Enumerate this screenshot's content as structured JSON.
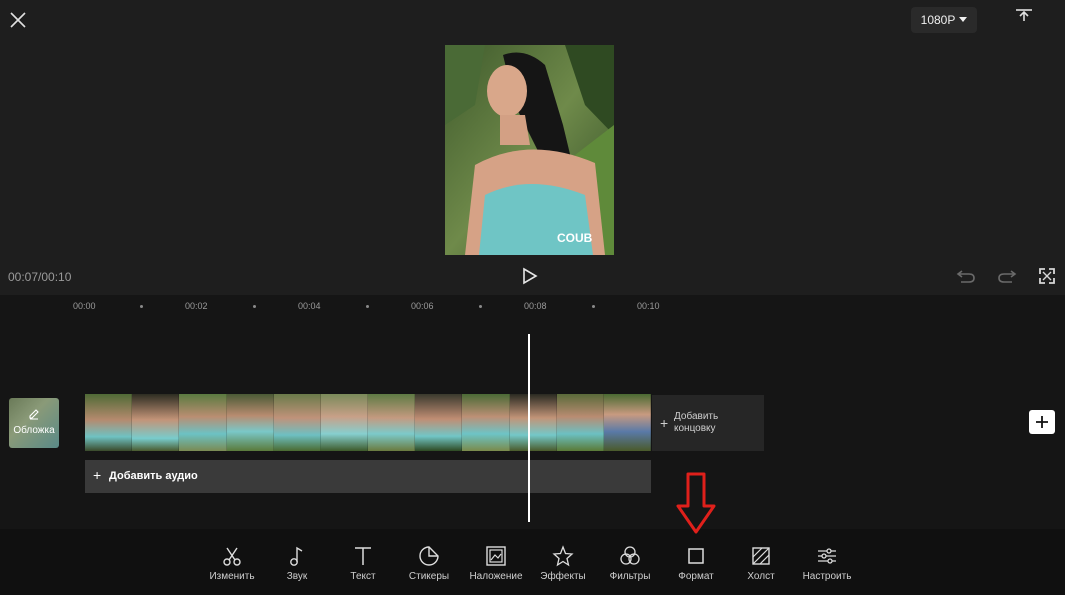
{
  "header": {
    "resolution": "1080P"
  },
  "preview": {
    "watermark": "COUB"
  },
  "playback": {
    "time": "00:07/00:10"
  },
  "ruler": {
    "ticks": [
      "00:00",
      "00:02",
      "00:04",
      "00:06",
      "00:08",
      "00:10"
    ]
  },
  "tracks": {
    "cover_label": "Обложка",
    "add_ending_line1": "Добавить",
    "add_ending_line2": "концовку",
    "add_audio": "Добавить аудио"
  },
  "toolbar": {
    "items": [
      {
        "label": "Изменить",
        "icon": "scissors-icon"
      },
      {
        "label": "Звук",
        "icon": "music-note-icon"
      },
      {
        "label": "Текст",
        "icon": "text-icon"
      },
      {
        "label": "Стикеры",
        "icon": "sticker-icon"
      },
      {
        "label": "Наложение",
        "icon": "overlay-icon"
      },
      {
        "label": "Эффекты",
        "icon": "effects-star-icon"
      },
      {
        "label": "Фильтры",
        "icon": "filters-icon"
      },
      {
        "label": "Формат",
        "icon": "format-square-icon"
      },
      {
        "label": "Холст",
        "icon": "canvas-icon"
      },
      {
        "label": "Настроить",
        "icon": "adjust-sliders-icon"
      }
    ]
  },
  "annotation": {
    "arrow_color": "#e0201b"
  }
}
